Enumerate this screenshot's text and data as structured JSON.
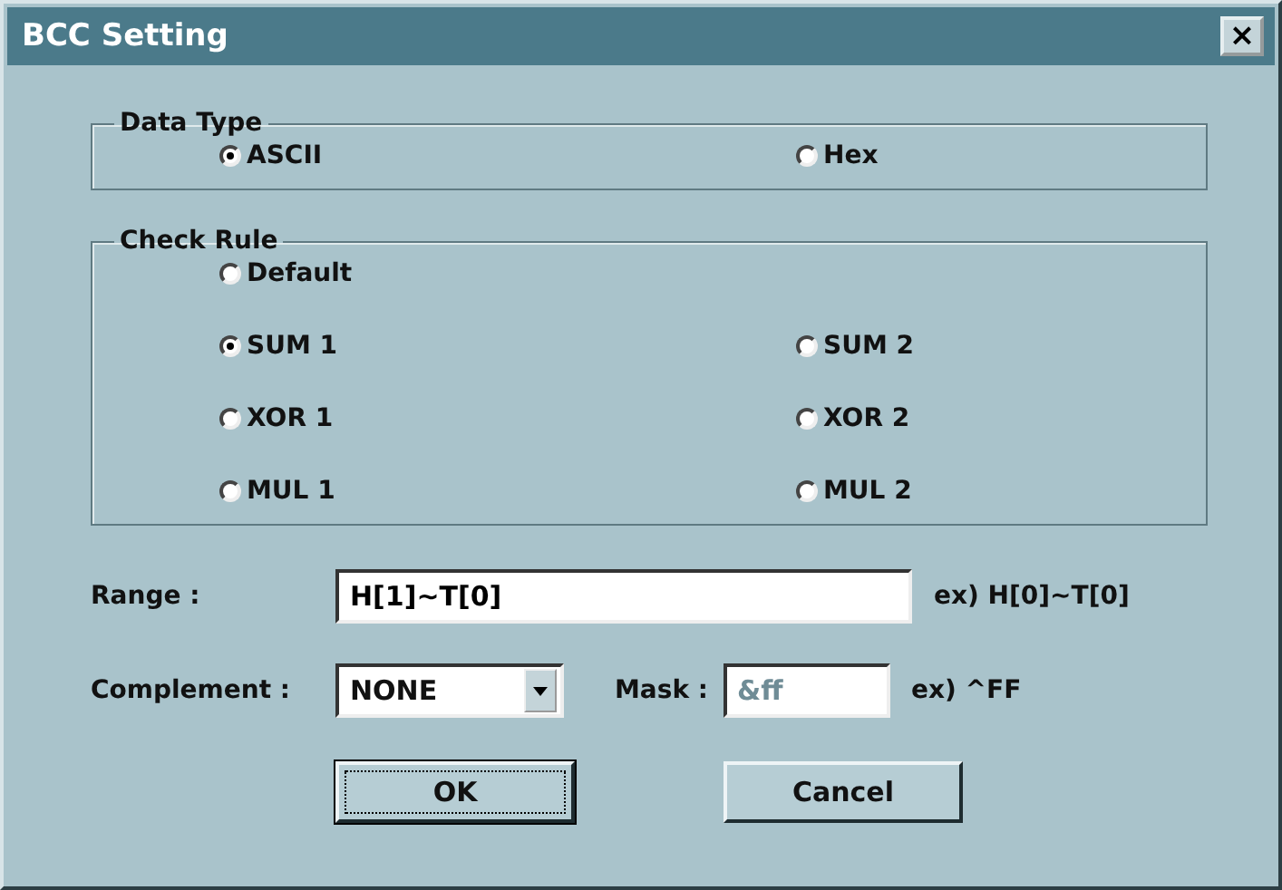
{
  "window": {
    "title": "BCC Setting",
    "close": "×"
  },
  "data_type": {
    "label": "Data Type",
    "options": [
      {
        "label": "ASCII",
        "selected": true
      },
      {
        "label": "Hex",
        "selected": false
      }
    ]
  },
  "check_rule": {
    "label": "Check Rule",
    "options": [
      {
        "label": "Default",
        "selected": false
      },
      {
        "label": "SUM 1",
        "selected": true
      },
      {
        "label": "SUM 2",
        "selected": false
      },
      {
        "label": "XOR 1",
        "selected": false
      },
      {
        "label": "XOR 2",
        "selected": false
      },
      {
        "label": "MUL 1",
        "selected": false
      },
      {
        "label": "MUL 2",
        "selected": false
      }
    ]
  },
  "range": {
    "label": "Range :",
    "value": "H[1]~T[0]",
    "hint": "ex) H[0]~T[0]"
  },
  "complement": {
    "label": "Complement :",
    "value": "NONE"
  },
  "mask": {
    "label": "Mask  :",
    "value": "&ff",
    "disabled": true,
    "hint": "ex) ^FF"
  },
  "buttons": [
    {
      "label": "OK",
      "focused": true
    },
    {
      "label": "Cancel",
      "focused": false
    }
  ]
}
